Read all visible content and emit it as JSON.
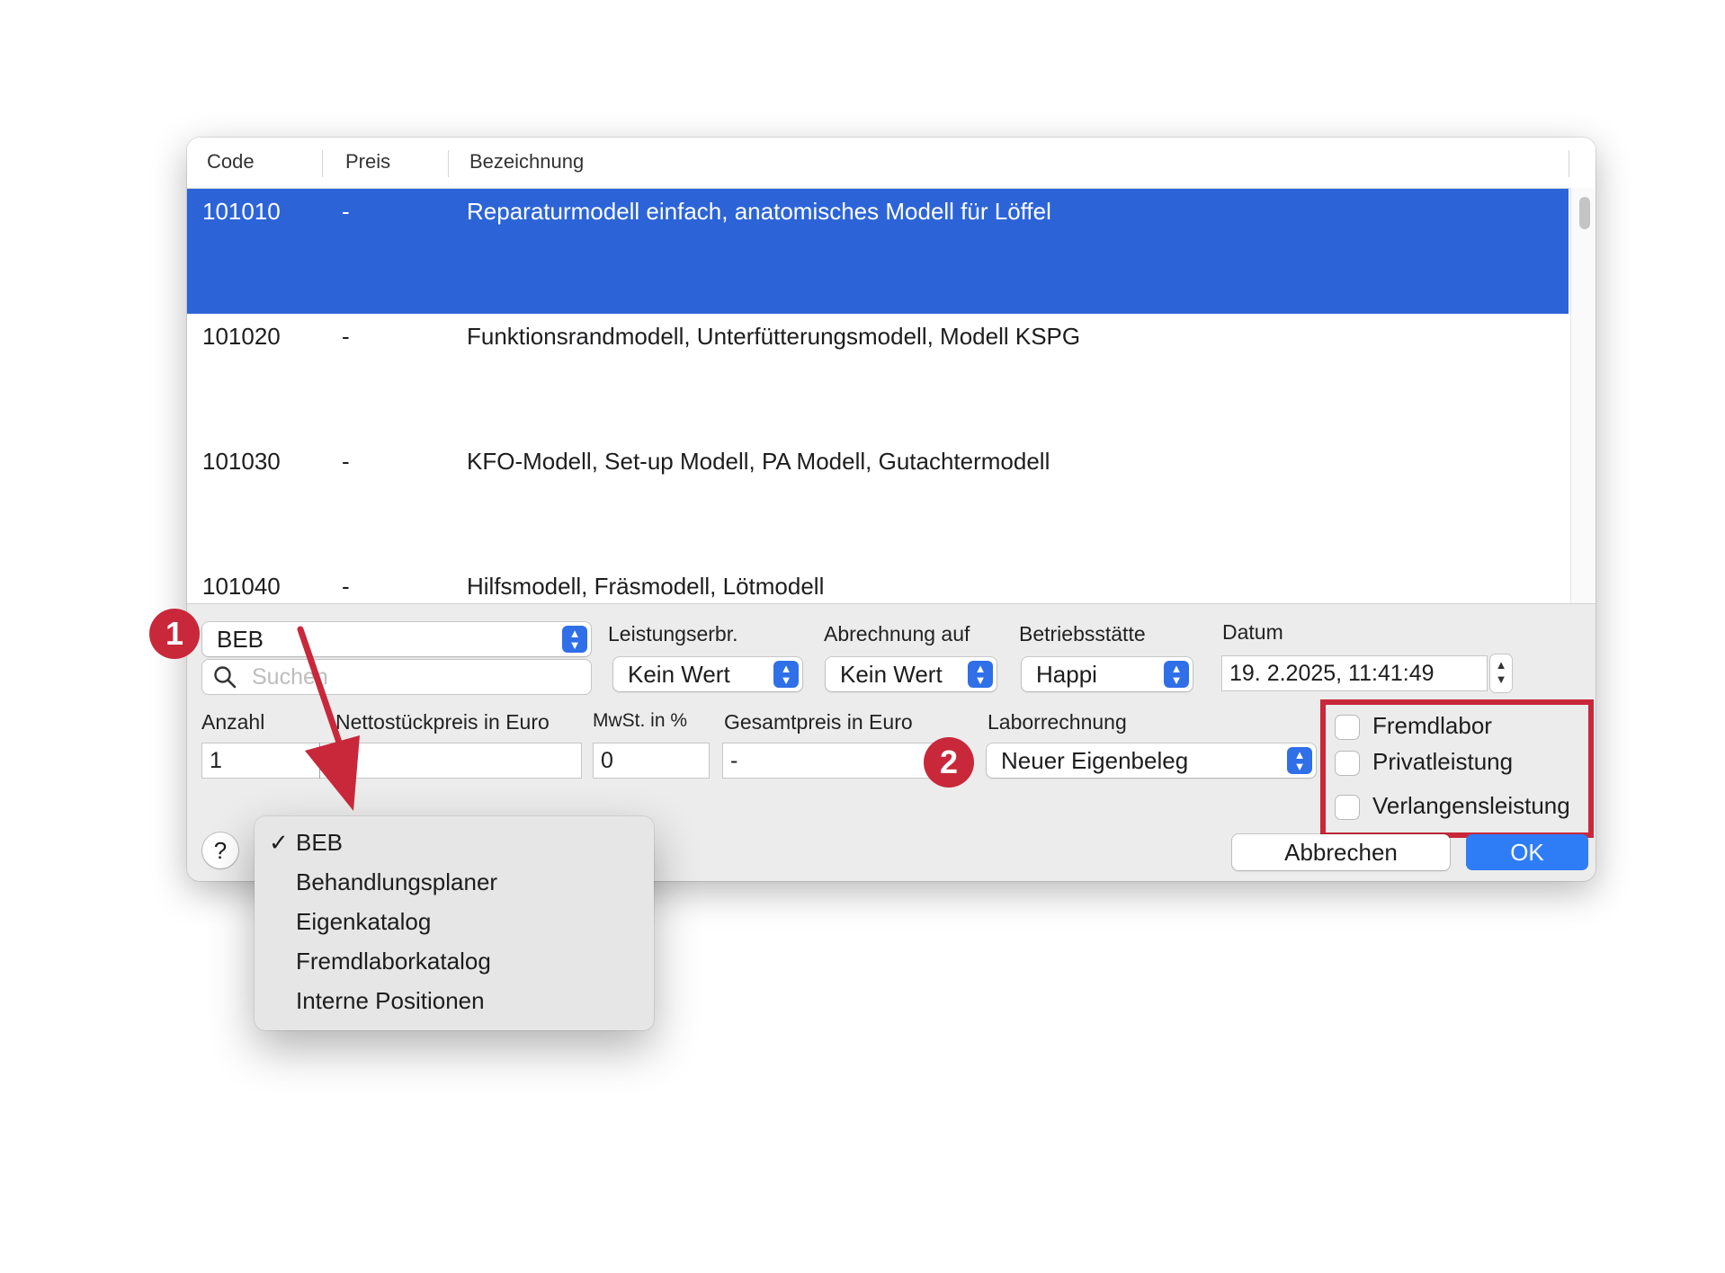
{
  "table": {
    "headers": {
      "code": "Code",
      "price": "Preis",
      "description": "Bezeichnung"
    },
    "rows": [
      {
        "code": "101010",
        "price": "-",
        "description": "Reparaturmodell einfach, anatomisches Modell für Löffel",
        "selected": true
      },
      {
        "code": "101020",
        "price": "-",
        "description": "Funktionsrandmodell, Unterfütterungsmodell, Modell KSPG"
      },
      {
        "code": "101030",
        "price": "-",
        "description": "KFO-Modell, Set-up Modell, PA Modell, Gutachtermodell"
      },
      {
        "code": "101040",
        "price": "-",
        "description": "Hilfsmodell, Fräsmodell, Lötmodell"
      }
    ]
  },
  "catalog": {
    "selected": "BEB"
  },
  "search": {
    "placeholder": "Suchen"
  },
  "fields": {
    "leistungserbr": {
      "label": "Leistungserbr.",
      "value": "Kein Wert"
    },
    "abrechnung": {
      "label": "Abrechnung auf",
      "value": "Kein Wert"
    },
    "betriebsstaette": {
      "label": "Betriebsstätte",
      "value": "Happi"
    },
    "datum": {
      "label": "Datum",
      "value": "19.  2.2025, 11:41:49"
    },
    "anzahl": {
      "label": "Anzahl",
      "value": "1"
    },
    "netto": {
      "label": "Nettostückpreis in Euro",
      "value": ""
    },
    "mwst": {
      "label": "MwSt. in %",
      "value": "0"
    },
    "gesamt": {
      "label": "Gesamtpreis in Euro",
      "value": "-"
    },
    "laborrechnung": {
      "label": "Laborrechnung",
      "value": "Neuer Eigenbeleg"
    }
  },
  "checkboxes": {
    "fremdlabor": "Fremdlabor",
    "privatleistung": "Privatleistung",
    "verlangensleistung": "Verlangensleistung"
  },
  "buttons": {
    "help": "?",
    "cancel": "Abbrechen",
    "ok": "OK"
  },
  "menu": {
    "items": [
      "BEB",
      "Behandlungsplaner",
      "Eigenkatalog",
      "Fremdlaborkatalog",
      "Interne Positionen"
    ],
    "checked": "✓"
  },
  "annotations": {
    "badge1": "1",
    "badge2": "2",
    "color": "#c8283a"
  },
  "colors": {
    "selection": "#2c64d8",
    "accent": "#2f7df6"
  }
}
